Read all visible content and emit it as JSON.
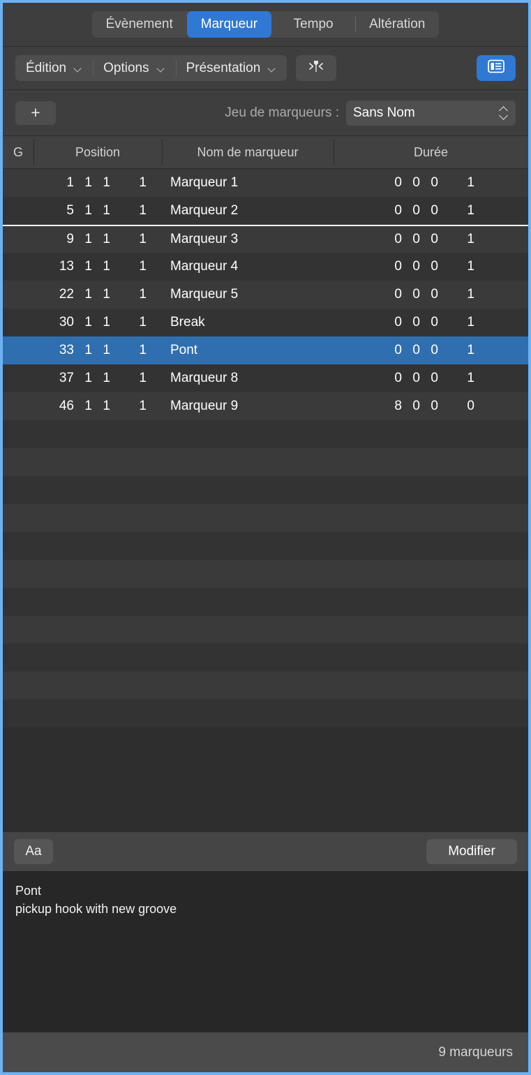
{
  "window": {
    "accent_color": "#2f78d4",
    "focus_border_color": "#6cb2f2"
  },
  "tabs": [
    {
      "label": "Évènement",
      "selected": false,
      "divider_before": false
    },
    {
      "label": "Marqueur",
      "selected": true,
      "divider_before": false
    },
    {
      "label": "Tempo",
      "selected": false,
      "divider_before": false
    },
    {
      "label": "Altération",
      "selected": false,
      "divider_before": true
    }
  ],
  "toolbar": {
    "menus": [
      {
        "label": "Édition",
        "icon": "chevron-down-icon"
      },
      {
        "label": "Options",
        "icon": "chevron-down-icon"
      },
      {
        "label": "Présentation",
        "icon": "chevron-down-icon"
      }
    ],
    "goto_marker_icon": "marker-pin-icon",
    "list_view_icon": "list-view-icon",
    "list_view_active": true
  },
  "marker_set": {
    "add_label": "+",
    "add_icon": "plus-icon",
    "label": "Jeu de marqueurs :",
    "value": "Sans Nom",
    "stepper_icon": "up-down-chevron-icon"
  },
  "columns": [
    {
      "key": "g",
      "label": "G"
    },
    {
      "key": "pos",
      "label": "Position"
    },
    {
      "key": "name",
      "label": "Nom de marqueur"
    },
    {
      "key": "dur",
      "label": "Durée"
    }
  ],
  "rows": [
    {
      "g": "",
      "pos": [
        "1",
        "1",
        "1",
        "1"
      ],
      "name": "Marqueur 1",
      "dur": [
        "0",
        "0",
        "0",
        "1"
      ],
      "selected": false,
      "cycle_marker": false
    },
    {
      "g": "",
      "pos": [
        "5",
        "1",
        "1",
        "1"
      ],
      "name": "Marqueur 2",
      "dur": [
        "0",
        "0",
        "0",
        "1"
      ],
      "selected": false,
      "cycle_marker": false
    },
    {
      "g": "",
      "pos": [
        "9",
        "1",
        "1",
        "1"
      ],
      "name": "Marqueur 3",
      "dur": [
        "0",
        "0",
        "0",
        "1"
      ],
      "selected": false,
      "cycle_marker": true
    },
    {
      "g": "",
      "pos": [
        "13",
        "1",
        "1",
        "1"
      ],
      "name": "Marqueur 4",
      "dur": [
        "0",
        "0",
        "0",
        "1"
      ],
      "selected": false,
      "cycle_marker": false
    },
    {
      "g": "",
      "pos": [
        "22",
        "1",
        "1",
        "1"
      ],
      "name": "Marqueur 5",
      "dur": [
        "0",
        "0",
        "0",
        "1"
      ],
      "selected": false,
      "cycle_marker": false
    },
    {
      "g": "",
      "pos": [
        "30",
        "1",
        "1",
        "1"
      ],
      "name": "Break",
      "dur": [
        "0",
        "0",
        "0",
        "1"
      ],
      "selected": false,
      "cycle_marker": false
    },
    {
      "g": "",
      "pos": [
        "33",
        "1",
        "1",
        "1"
      ],
      "name": "Pont",
      "dur": [
        "0",
        "0",
        "0",
        "1"
      ],
      "selected": true,
      "cycle_marker": false
    },
    {
      "g": "",
      "pos": [
        "37",
        "1",
        "1",
        "1"
      ],
      "name": "Marqueur 8",
      "dur": [
        "0",
        "0",
        "0",
        "1"
      ],
      "selected": false,
      "cycle_marker": false
    },
    {
      "g": "",
      "pos": [
        "46",
        "1",
        "1",
        "1"
      ],
      "name": "Marqueur 9",
      "dur": [
        "8",
        "0",
        "0",
        "0"
      ],
      "selected": false,
      "cycle_marker": false
    }
  ],
  "empty_row_count": 11,
  "text_toolbar": {
    "font_button_label": "Aa",
    "font_button_icon": "font-icon",
    "edit_button_label": "Modifier"
  },
  "text_area": {
    "content": "Pont\npickup hook with new groove"
  },
  "status_bar": {
    "count_label": "9 marqueurs"
  }
}
